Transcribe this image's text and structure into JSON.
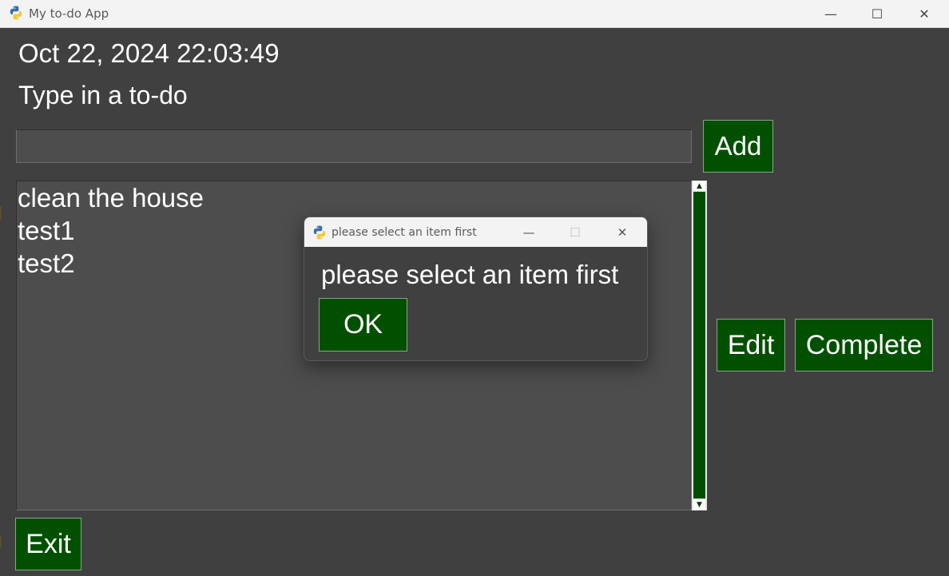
{
  "window": {
    "title": "My to-do App",
    "controls": {
      "minimize": "—",
      "maximize": "☐",
      "close": "✕"
    }
  },
  "main": {
    "clock": "Oct 22, 2024 22:03:49",
    "prompt": "Type in a to-do",
    "input": {
      "value": "",
      "placeholder": ""
    },
    "add_label": "Add",
    "items": [
      "clean the house",
      "test1",
      "test2"
    ],
    "edit_label": "Edit",
    "complete_label": "Complete",
    "exit_label": "Exit",
    "scrollbar": {
      "up_arrow": "▲",
      "down_arrow": "▼"
    }
  },
  "dialog": {
    "title": "please select an item first",
    "message": "please select an item first",
    "ok_label": "OK",
    "controls": {
      "minimize": "—",
      "maximize": "☐",
      "close": "✕"
    }
  },
  "colors": {
    "background": "#404040",
    "button_green": "#005000",
    "text": "#ffffff",
    "titlebar": "#f3f3f3"
  },
  "icons": {
    "app": "python-icon",
    "dialog": "python-icon"
  }
}
